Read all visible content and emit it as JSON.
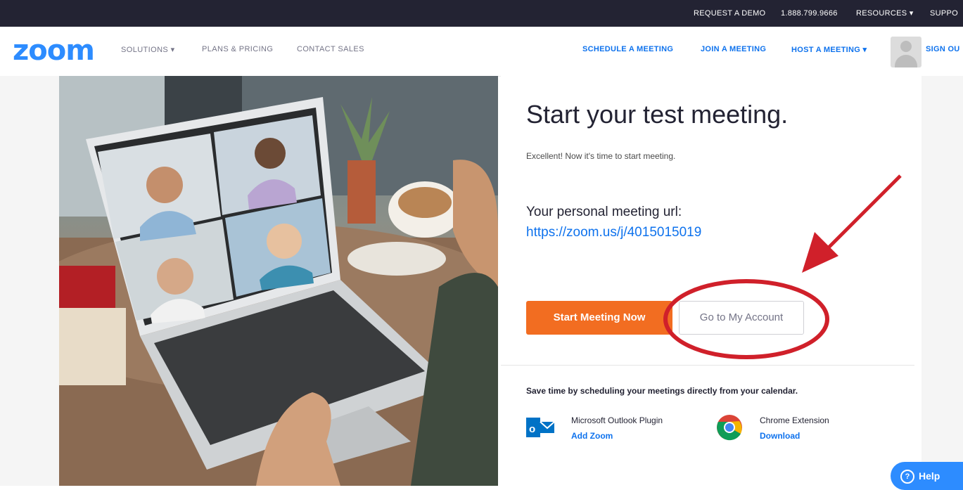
{
  "topbar": {
    "request_demo": "REQUEST A DEMO",
    "phone": "1.888.799.9666",
    "resources": "RESOURCES",
    "support": "SUPPO"
  },
  "nav": {
    "logo": "zoom",
    "solutions": "SOLUTIONS",
    "plans_pricing": "PLANS & PRICING",
    "contact_sales": "CONTACT SALES",
    "schedule": "SCHEDULE A MEETING",
    "join": "JOIN A MEETING",
    "host": "HOST A MEETING",
    "sign_out": "SIGN OU"
  },
  "main": {
    "headline": "Start your test meeting.",
    "subline": "Excellent! Now it's time to start meeting.",
    "url_label": "Your personal meeting url:",
    "url": "https://zoom.us/j/4015015019",
    "start_button": "Start Meeting Now",
    "account_button": "Go to My Account"
  },
  "calendar": {
    "save_time": "Save time by scheduling your meetings directly from your calendar.",
    "outlook_name": "Microsoft Outlook Plugin",
    "outlook_link": "Add Zoom",
    "chrome_name": "Chrome Extension",
    "chrome_link": "Download"
  },
  "help": {
    "label": "Help"
  },
  "icons": {
    "outlook": "outlook-icon",
    "chrome": "chrome-icon",
    "help": "question-circle-icon",
    "avatar": "user-avatar"
  },
  "colors": {
    "brand_blue": "#2d8cff",
    "link_blue": "#0e72ed",
    "orange": "#f26d21",
    "topbar": "#232333",
    "annotation_red": "#d0202a"
  }
}
